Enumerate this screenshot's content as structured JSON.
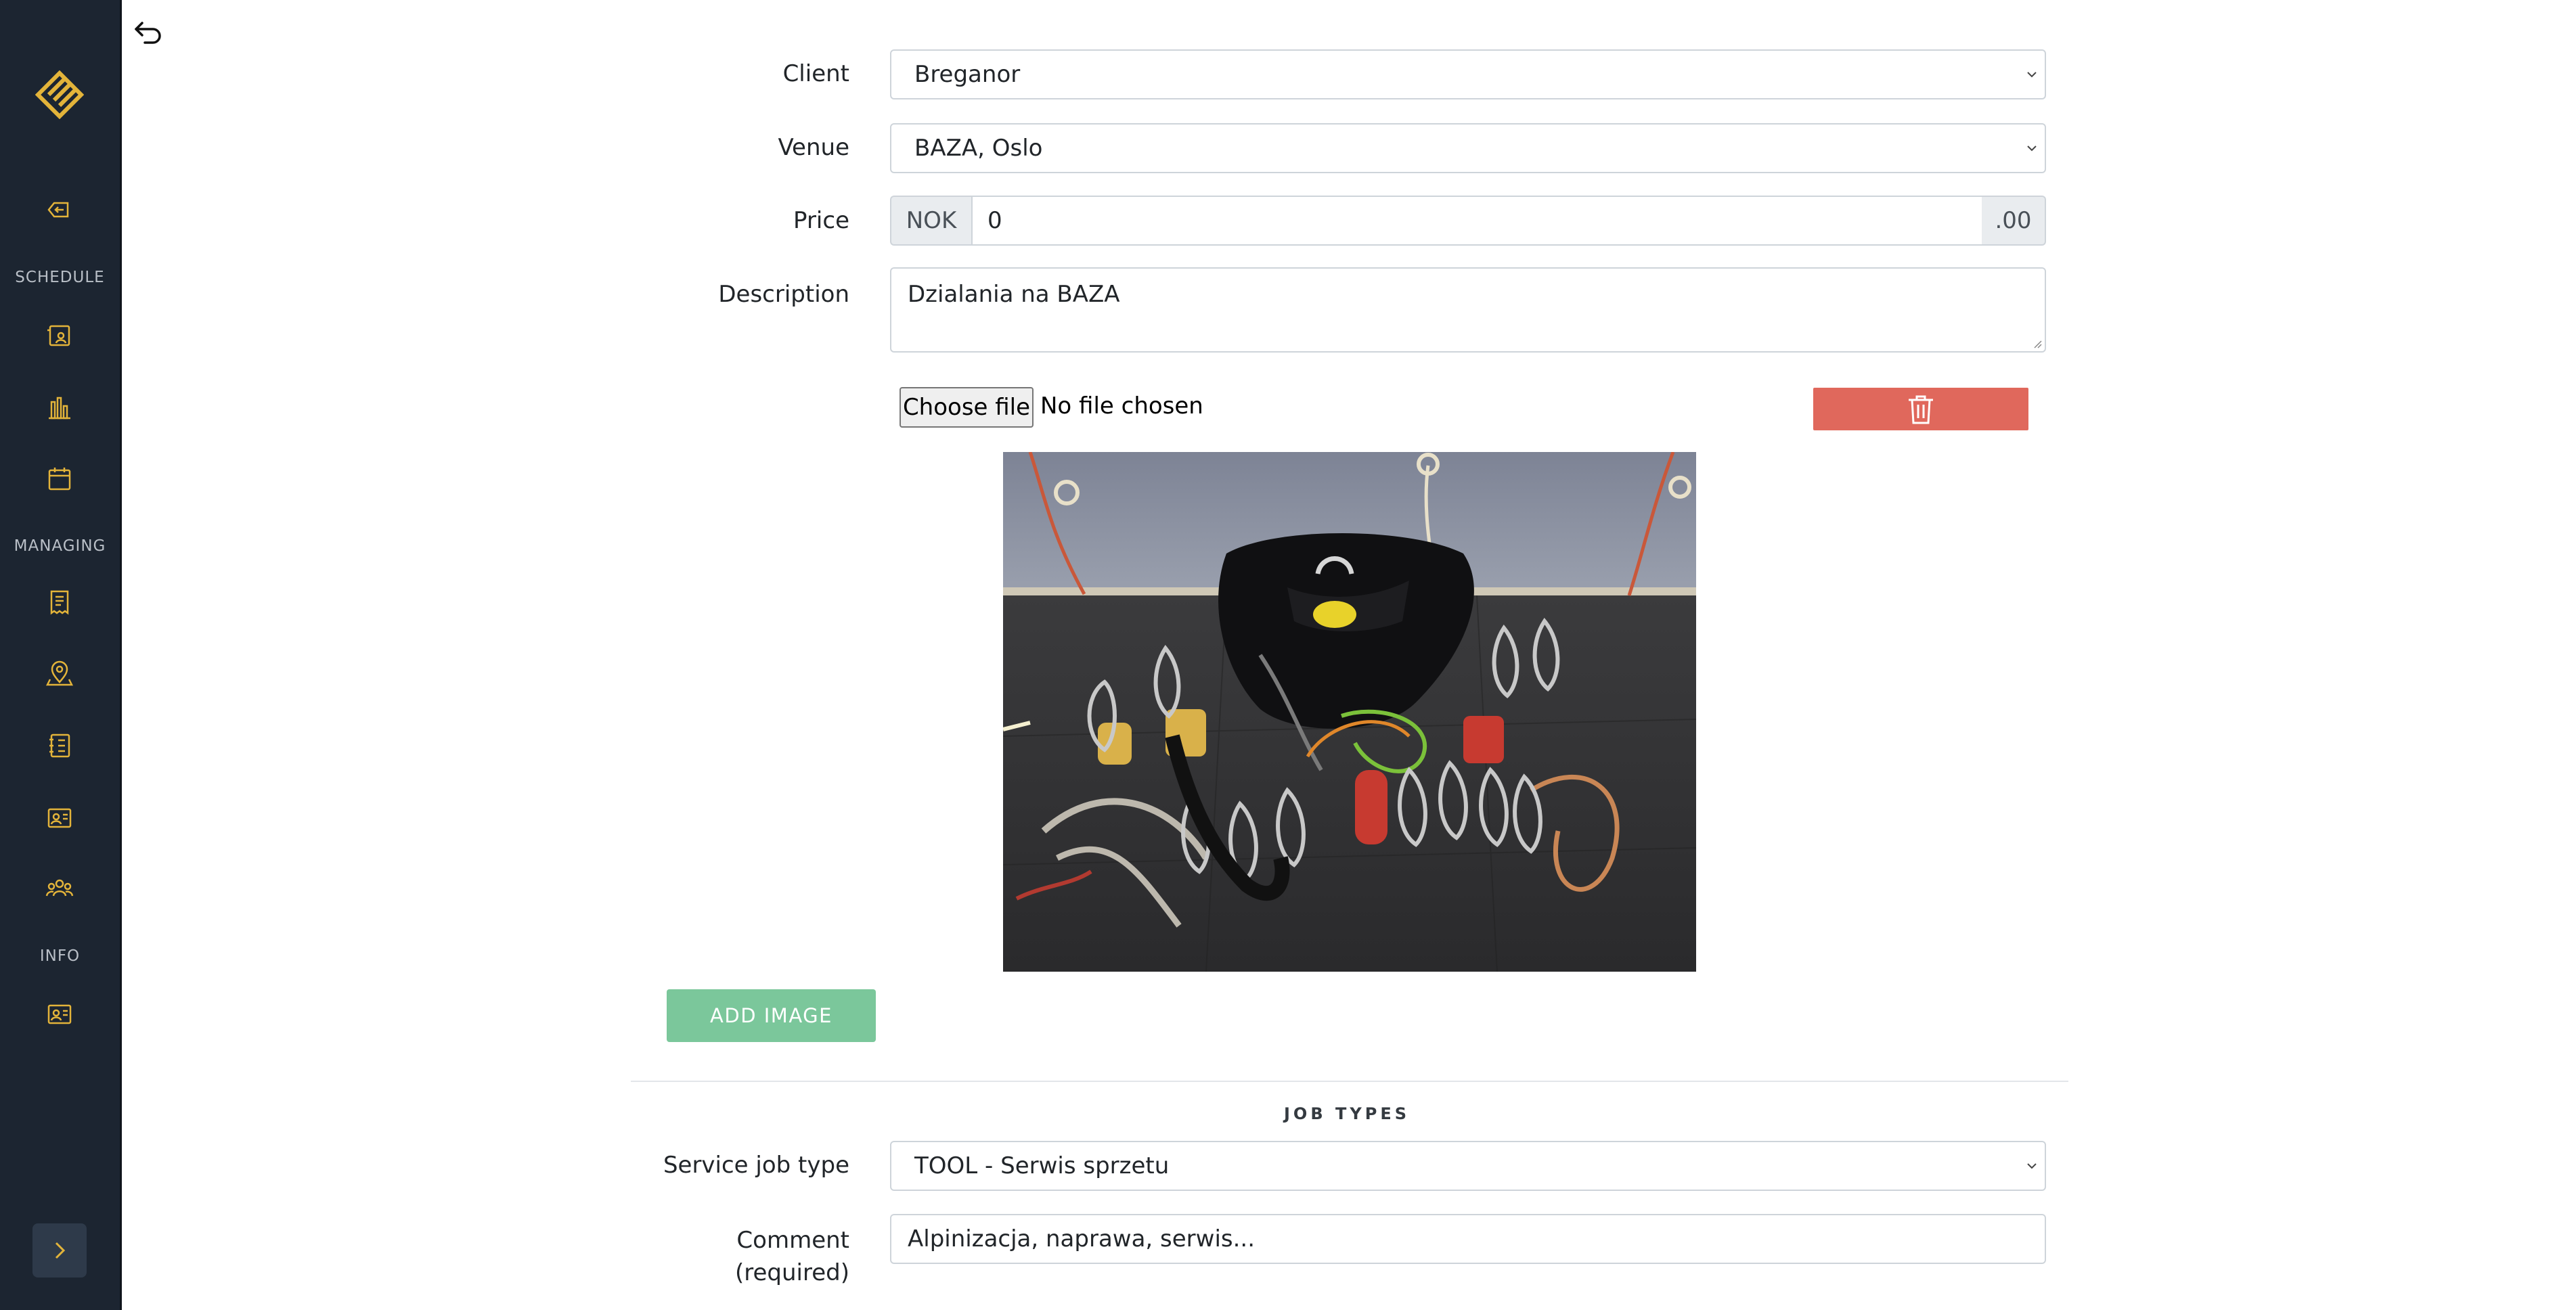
{
  "sidebar": {
    "sections": {
      "schedule": "SCHEDULE",
      "managing": "MANAGING",
      "info": "INFO"
    },
    "icons": [
      "logo-icon",
      "logout-icon",
      "user-schedule-icon",
      "bar-chart-icon",
      "calendar-icon",
      "receipt-icon",
      "map-pin-icon",
      "notebook-icon",
      "id-card-icon",
      "team-icon",
      "info-card-icon",
      "chevron-right-icon"
    ]
  },
  "form": {
    "client": {
      "label": "Client",
      "value": "Breganor"
    },
    "venue": {
      "label": "Venue",
      "value": "BAZA, Oslo"
    },
    "price": {
      "label": "Price",
      "currency": "NOK",
      "value": "0",
      "suffix": ".00"
    },
    "description": {
      "label": "Description",
      "value": "Dzialania na BAZA"
    },
    "file": {
      "button": "Choose file",
      "status": "No file chosen"
    },
    "add_image": "ADD IMAGE"
  },
  "job_types": {
    "title": "JOB TYPES",
    "service": {
      "label": "Service job type",
      "value": "TOOL - Serwis sprzetu"
    },
    "comment": {
      "label_line1": "Comment",
      "label_line2": "(required)",
      "value": "Alpinizacja, naprawa, serwis..."
    }
  },
  "colors": {
    "sidebar_bg": "#1c2531",
    "accent_gold": "#e3b43a",
    "delete_red": "#e0685c",
    "add_green": "#7bc79b"
  }
}
